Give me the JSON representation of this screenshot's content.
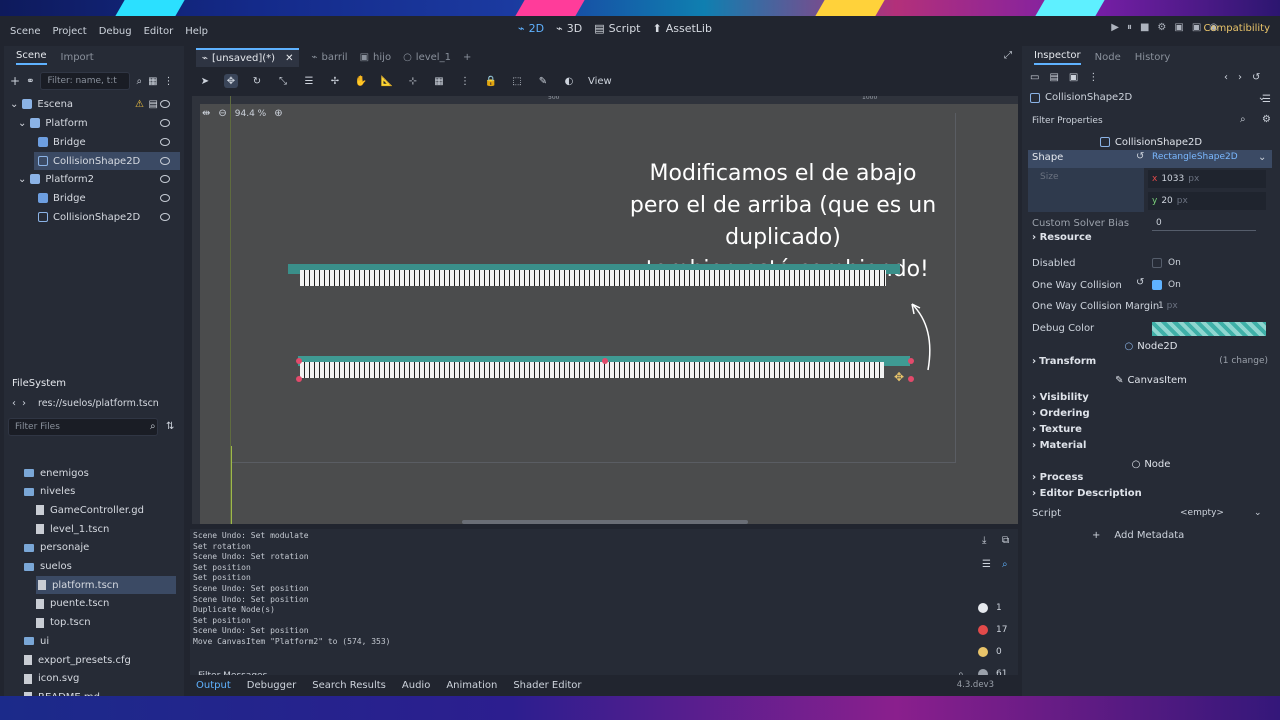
{
  "menubar": {
    "items": [
      "Scene",
      "Project",
      "Debug",
      "Editor",
      "Help"
    ]
  },
  "workspaces": {
    "tabs": [
      {
        "label": "2D",
        "active": true
      },
      {
        "label": "3D"
      },
      {
        "label": "Script"
      },
      {
        "label": "AssetLib"
      }
    ],
    "compat": "Compatibility"
  },
  "scene_dock": {
    "tabs": [
      "Scene",
      "Import"
    ],
    "filter_placeholder": "Filter: name, t:t",
    "tree": [
      {
        "label": "Escena",
        "depth": 0,
        "warning": true
      },
      {
        "label": "Platform",
        "depth": 1
      },
      {
        "label": "Bridge",
        "depth": 2
      },
      {
        "label": "CollisionShape2D",
        "depth": 2,
        "selected": true
      },
      {
        "label": "Platform2",
        "depth": 1
      },
      {
        "label": "Bridge",
        "depth": 2
      },
      {
        "label": "CollisionShape2D",
        "depth": 2
      }
    ]
  },
  "filesystem": {
    "title": "FileSystem",
    "path": "res://suelos/platform.tscn",
    "filter_placeholder": "Filter Files",
    "items": [
      {
        "label": "enemigos",
        "type": "folder",
        "depth": 1
      },
      {
        "label": "niveles",
        "type": "folder",
        "depth": 1
      },
      {
        "label": "GameController.gd",
        "type": "file",
        "depth": 2
      },
      {
        "label": "level_1.tscn",
        "type": "file",
        "depth": 2
      },
      {
        "label": "personaje",
        "type": "folder",
        "depth": 1
      },
      {
        "label": "suelos",
        "type": "folder",
        "depth": 1
      },
      {
        "label": "platform.tscn",
        "type": "file",
        "depth": 2,
        "selected": true
      },
      {
        "label": "puente.tscn",
        "type": "file",
        "depth": 2
      },
      {
        "label": "top.tscn",
        "type": "file",
        "depth": 2
      },
      {
        "label": "ui",
        "type": "folder",
        "depth": 1
      },
      {
        "label": "export_presets.cfg",
        "type": "file",
        "depth": 1
      },
      {
        "label": "icon.svg",
        "type": "file",
        "depth": 1
      },
      {
        "label": "README.md",
        "type": "file",
        "depth": 1
      }
    ]
  },
  "doc_tabs": [
    {
      "label": "[unsaved](*)",
      "active": true
    },
    {
      "label": "barril"
    },
    {
      "label": "hijo"
    },
    {
      "label": "level_1"
    }
  ],
  "toolbar": {
    "view_label": "View"
  },
  "viewport": {
    "zoom": "94.4 %",
    "ruler_marks": [
      "500",
      "1000"
    ],
    "caption_lines": [
      "Modificamos el de abajo",
      "pero el de arriba (que es un duplicado)",
      "¡tambien está cambiando!"
    ]
  },
  "output": {
    "lines": [
      "Scene Undo: Set modulate",
      "Set rotation",
      "Scene Undo: Set rotation",
      "Set position",
      "Set position",
      "Scene Undo: Set position",
      "Scene Undo: Set position",
      "Duplicate Node(s)",
      "Set position",
      "Scene Undo: Set position",
      "Move CanvasItem \"Platform2\" to (574, 353)"
    ],
    "counters": [
      "1",
      "17",
      "0",
      "61"
    ],
    "filter_placeholder": "Filter Messages",
    "tabs": [
      {
        "label": "Output",
        "active": true
      },
      {
        "label": "Debugger"
      },
      {
        "label": "Search Results"
      },
      {
        "label": "Audio"
      },
      {
        "label": "Animation"
      },
      {
        "label": "Shader Editor"
      }
    ],
    "version": "4.3.dev3"
  },
  "inspector": {
    "tabs": [
      "Inspector",
      "Node",
      "History"
    ],
    "node": "CollisionShape2D",
    "filter_placeholder": "Filter Properties",
    "class_header": "CollisionShape2D",
    "shape_label": "Shape",
    "shape_value": "RectangleShape2D",
    "size_label": "Size",
    "size_x": "1033",
    "size_y": "20",
    "unit": "px",
    "custom_solver_bias_label": "Custom Solver Bias",
    "custom_solver_bias": "0",
    "resource_label": "Resource",
    "disabled_label": "Disabled",
    "disabled_value": "On",
    "one_way_label": "One Way Collision",
    "one_way_value": "On",
    "one_way_margin_label": "One Way Collision Margin",
    "one_way_margin": "1",
    "debug_color_label": "Debug Color",
    "node2d_header": "Node2D",
    "transform_label": "Transform",
    "transform_change": "(1 change)",
    "canvasitem_header": "CanvasItem",
    "groups": [
      "Visibility",
      "Ordering",
      "Texture",
      "Material"
    ],
    "node_header": "Node",
    "node_groups": [
      "Process",
      "Editor Description"
    ],
    "script_label": "Script",
    "script_value": "<empty>",
    "add_metadata": "Add Metadata"
  }
}
